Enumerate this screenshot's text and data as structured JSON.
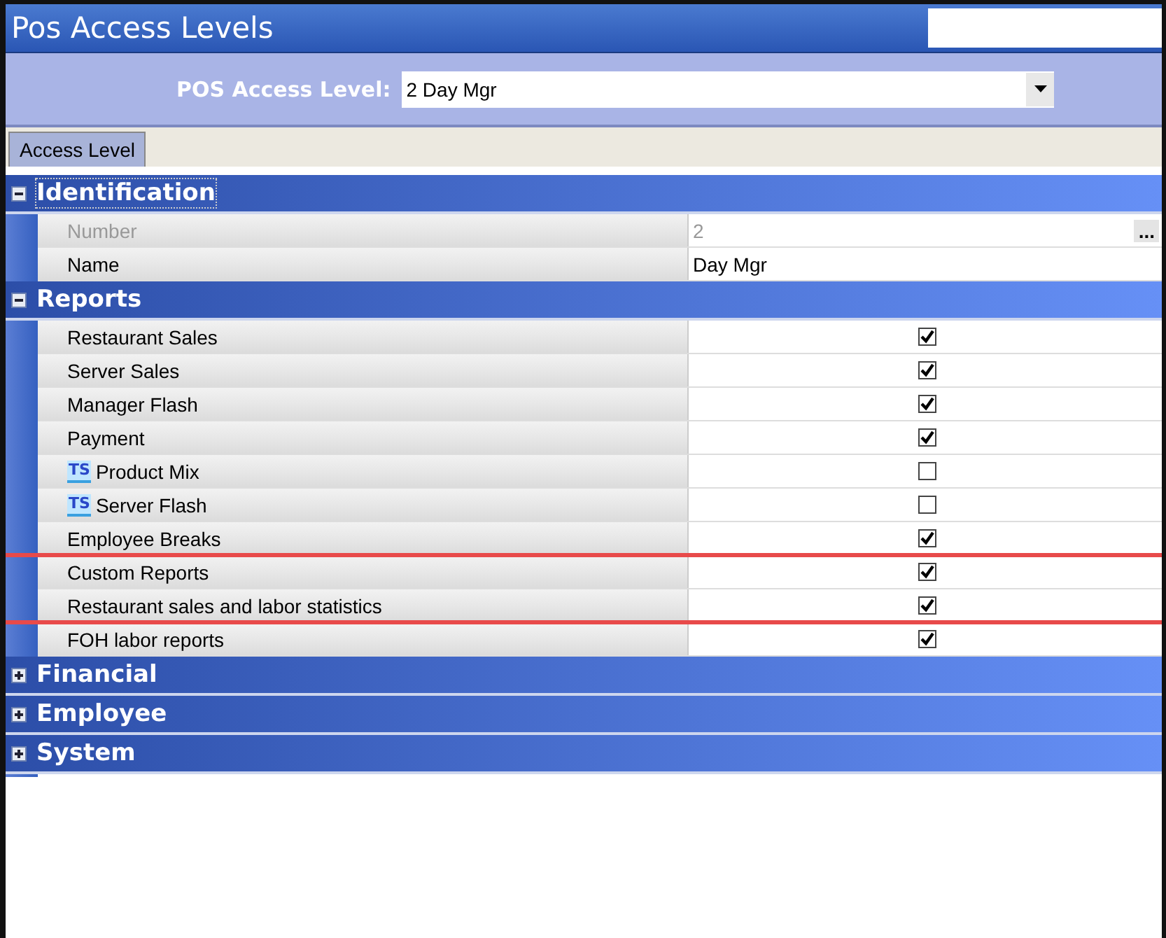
{
  "window": {
    "title": "Pos Access Levels"
  },
  "selector": {
    "label": "POS Access Level:",
    "value": "2 Day Mgr"
  },
  "tabs": [
    {
      "label": "Access Level",
      "selected": true
    }
  ],
  "groups": [
    {
      "title": "Identification",
      "expanded": true,
      "focused": true,
      "rows": [
        {
          "kind": "text",
          "label": "Number",
          "value": "2",
          "disabled": true,
          "button": "..."
        },
        {
          "kind": "text",
          "label": "Name",
          "value": "Day Mgr",
          "disabled": false
        }
      ]
    },
    {
      "title": "Reports",
      "expanded": true,
      "focused": false,
      "rows": [
        {
          "kind": "checkbox",
          "label": "Restaurant Sales",
          "checked": true,
          "struck": false
        },
        {
          "kind": "checkbox",
          "label": "Server Sales",
          "checked": true,
          "struck": false
        },
        {
          "kind": "checkbox",
          "label": "Manager Flash",
          "checked": true,
          "struck": false
        },
        {
          "kind": "checkbox",
          "label": "Payment",
          "checked": true,
          "struck": false
        },
        {
          "kind": "checkbox",
          "label": "Product Mix",
          "tag": "TS",
          "checked": false,
          "struck": false
        },
        {
          "kind": "checkbox",
          "label": "Server Flash",
          "tag": "TS",
          "checked": false,
          "struck": false
        },
        {
          "kind": "checkbox",
          "label": "Employee Breaks",
          "checked": true,
          "struck": true
        },
        {
          "kind": "checkbox",
          "label": "Custom Reports",
          "checked": true,
          "struck": false
        },
        {
          "kind": "checkbox",
          "label": "Restaurant sales and labor statistics",
          "checked": true,
          "struck": true
        },
        {
          "kind": "checkbox",
          "label": "FOH labor reports",
          "checked": true,
          "struck": false
        }
      ]
    },
    {
      "title": "Financial",
      "expanded": false,
      "focused": false
    },
    {
      "title": "Employee",
      "expanded": false,
      "focused": false
    },
    {
      "title": "System",
      "expanded": false,
      "focused": false
    }
  ]
}
